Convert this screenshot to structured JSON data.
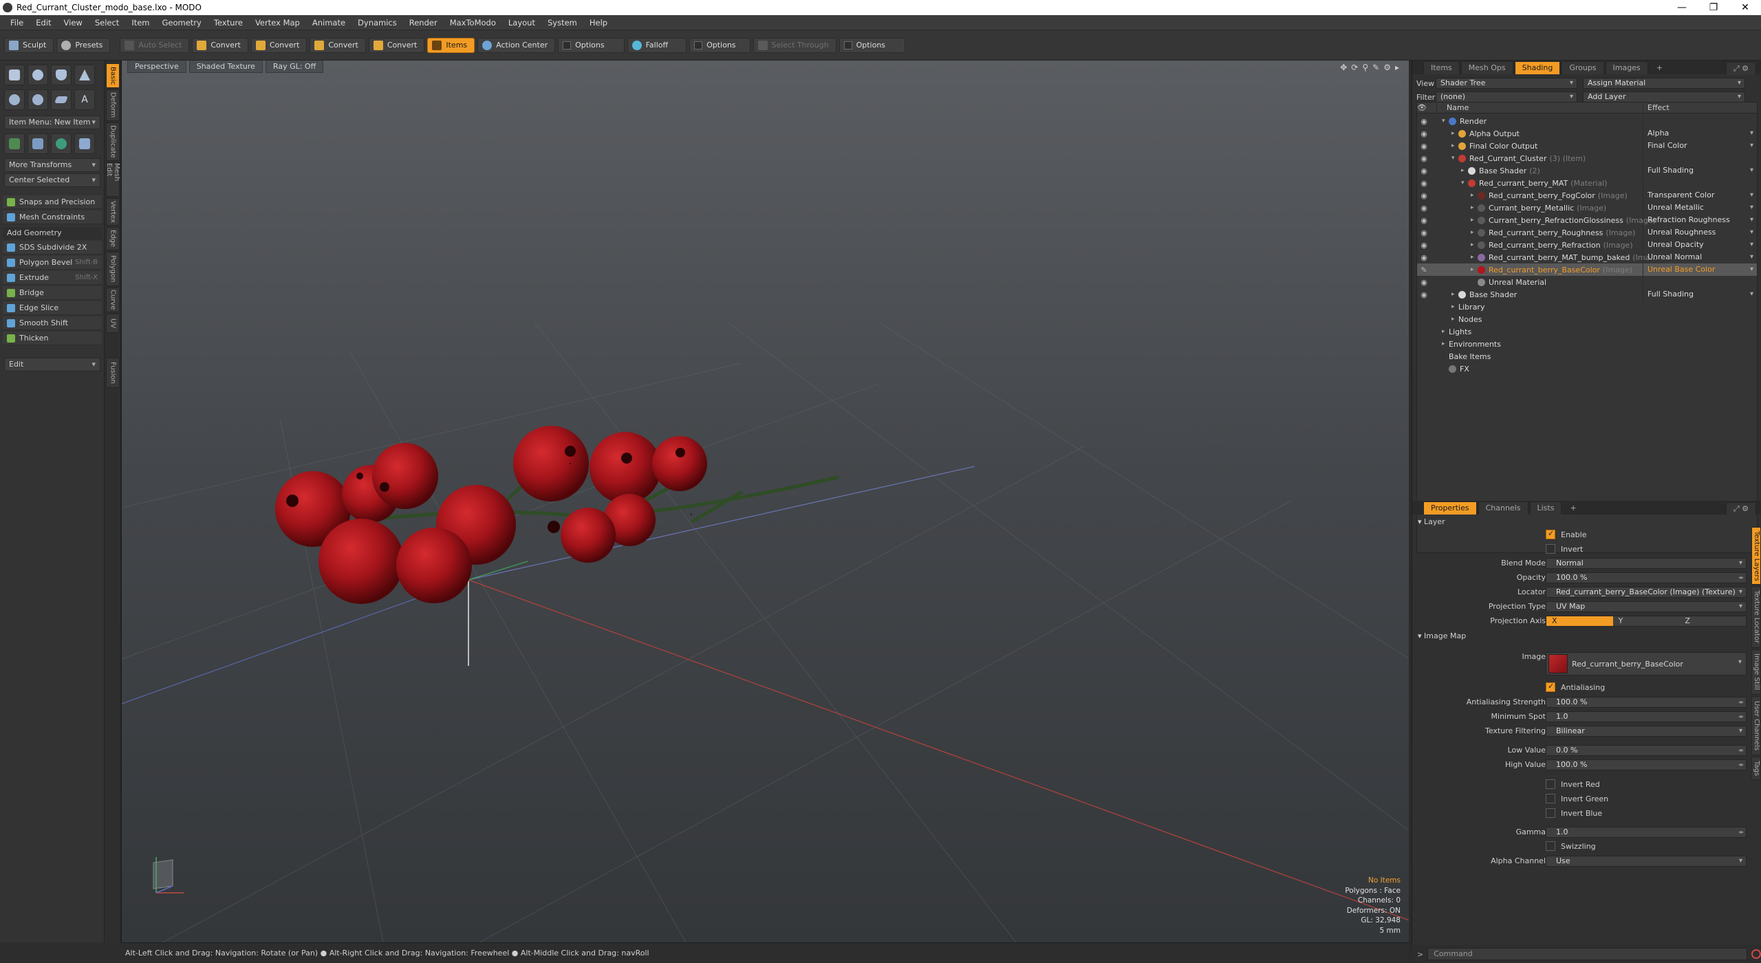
{
  "window": {
    "title": "Red_Currant_Cluster_modo_base.lxo - MODO",
    "controls": [
      "—",
      "❐",
      "✕"
    ]
  },
  "menu": [
    "File",
    "Edit",
    "View",
    "Select",
    "Item",
    "Geometry",
    "Texture",
    "Vertex Map",
    "Animate",
    "Dynamics",
    "Render",
    "MaxToModo",
    "Layout",
    "System",
    "Help"
  ],
  "toolbar": {
    "sculpt": "Sculpt",
    "presets": "Presets",
    "auto_select": "Auto Select",
    "convert1": "Convert",
    "convert2": "Convert",
    "convert3": "Convert",
    "convert4": "Convert",
    "items": "Items",
    "action_center": "Action Center",
    "options1": "Options",
    "falloff": "Falloff",
    "options2": "Options",
    "select_through": "Select Through",
    "options3": "Options"
  },
  "left_panel": {
    "item_menu": "Item Menu: New Item",
    "more_transforms": "More Transforms",
    "center_selected": "Center Selected",
    "snaps": "Snaps and Precision",
    "mesh_constraints": "Mesh Constraints",
    "add_geometry": "Add Geometry",
    "sds": "SDS Subdivide 2X",
    "polygon_bevel": "Polygon Bevel",
    "polygon_bevel_sc": "Shift-B",
    "extrude": "Extrude",
    "extrude_sc": "Shift-X",
    "bridge": "Bridge",
    "edge_slice": "Edge Slice",
    "smooth_shift": "Smooth Shift",
    "thicken": "Thicken",
    "edit": "Edit"
  },
  "vertical_tabs": [
    "Basic",
    "Deform",
    "Duplicate",
    "Mesh Edit",
    "Vertex",
    "Edge",
    "Polygon",
    "Curve",
    "UV",
    "Fusion"
  ],
  "viewport": {
    "tabs": [
      "Perspective",
      "Shaded Texture",
      "Ray GL: Off"
    ],
    "icons": [
      "✥",
      "⟳",
      "⚲",
      "✎",
      "⚙",
      "▸"
    ],
    "info": [
      "No Items",
      "Polygons : Face",
      "Channels: 0",
      "Deformers: ON",
      "GL: 32,948",
      "5 mm"
    ]
  },
  "status_bar": "Alt-Left Click and Drag: Navigation: Rotate (or Pan) ● Alt-Right Click and Drag: Navigation: Freewheel ● Alt-Middle Click and Drag: navRoll",
  "top_right": {
    "tabs": [
      "Items",
      "Mesh Ops",
      "Shading",
      "Groups",
      "Images"
    ],
    "active_tab": "Shading",
    "view_label": "View",
    "view_value": "Shader Tree",
    "assign_material": "Assign Material",
    "filter_label": "Filter",
    "filter_value": "(none)",
    "add_layer": "Add Layer",
    "col_name": "Name",
    "col_effect": "Effect",
    "rows": [
      {
        "name": "Render",
        "sub": "",
        "effect": ""
      },
      {
        "name": "Alpha Output",
        "sub": "",
        "effect": "Alpha"
      },
      {
        "name": "Final Color Output",
        "sub": "",
        "effect": "Final Color"
      },
      {
        "name": "Red_Currant_Cluster",
        "sub": "(3) (Item)",
        "effect": ""
      },
      {
        "name": "Base Shader",
        "sub": "(2)",
        "effect": "Full Shading"
      },
      {
        "name": "Red_currant_berry_MAT",
        "sub": "(Material)",
        "effect": ""
      },
      {
        "name": "Red_currant_berry_FogColor",
        "sub": "(Image)",
        "effect": "Transparent Color"
      },
      {
        "name": "Currant_berry_Metallic",
        "sub": "(Image)",
        "effect": "Unreal Metallic"
      },
      {
        "name": "Currant_berry_RefractionGlossiness",
        "sub": "(Image)",
        "effect": "Refraction Roughness"
      },
      {
        "name": "Red_currant_berry_Roughness",
        "sub": "(Image)",
        "effect": "Unreal Roughness"
      },
      {
        "name": "Red_currant_berry_Refraction",
        "sub": "(Image)",
        "effect": "Unreal Opacity"
      },
      {
        "name": "Red_currant_berry_MAT_bump_baked",
        "sub": "(Ima...",
        "effect": "Unreal Normal"
      },
      {
        "name": "Red_currant_berry_BaseColor",
        "sub": "(Image)",
        "effect": "Unreal Base Color"
      },
      {
        "name": "Unreal Material",
        "sub": "",
        "effect": ""
      },
      {
        "name": "Base Shader",
        "sub": "",
        "effect": "Full Shading"
      },
      {
        "name": "Library",
        "sub": "",
        "effect": ""
      },
      {
        "name": "Nodes",
        "sub": "",
        "effect": ""
      },
      {
        "name": "Lights",
        "sub": "",
        "effect": ""
      },
      {
        "name": "Environments",
        "sub": "",
        "effect": ""
      },
      {
        "name": "Bake Items",
        "sub": "",
        "effect": ""
      },
      {
        "name": "FX",
        "sub": "",
        "effect": ""
      }
    ]
  },
  "properties": {
    "tabs": [
      "Properties",
      "Channels",
      "Lists"
    ],
    "active_tab": "Properties",
    "layer_section": "Layer",
    "enable": "Enable",
    "invert": "Invert",
    "blend_mode_label": "Blend Mode",
    "blend_mode": "Normal",
    "opacity_label": "Opacity",
    "opacity": "100.0 %",
    "locator_label": "Locator",
    "locator": "Red_currant_berry_BaseColor (Image) (Texture)",
    "projection_type_label": "Projection Type",
    "projection_type": "UV Map",
    "projection_axis_label": "Projection Axis",
    "axis": [
      "X",
      "Y",
      "Z"
    ],
    "image_map_section": "Image Map",
    "image_label": "Image",
    "image": "Red_currant_berry_BaseColor",
    "antialiasing": "Antialiasing",
    "aa_strength_label": "Antialiasing Strength",
    "aa_strength": "100.0 %",
    "min_spot_label": "Minimum Spot",
    "min_spot": "1.0",
    "tex_filter_label": "Texture Filtering",
    "tex_filter": "Bilinear",
    "low_label": "Low Value",
    "low": "0.0 %",
    "high_label": "High Value",
    "high": "100.0 %",
    "invert_red": "Invert Red",
    "invert_green": "Invert Green",
    "invert_blue": "Invert Blue",
    "gamma_label": "Gamma",
    "gamma": "1.0",
    "swizzling": "Swizzling",
    "alpha_channel_label": "Alpha Channel",
    "alpha_channel": "Use",
    "side_tabs": [
      "Texture Layers",
      "Texture Locator",
      "Image Still",
      "User Channels",
      "Tags"
    ]
  },
  "command_placeholder": "Command",
  "colors": {
    "accent": "#f39c24",
    "berry": "#b3141c"
  }
}
